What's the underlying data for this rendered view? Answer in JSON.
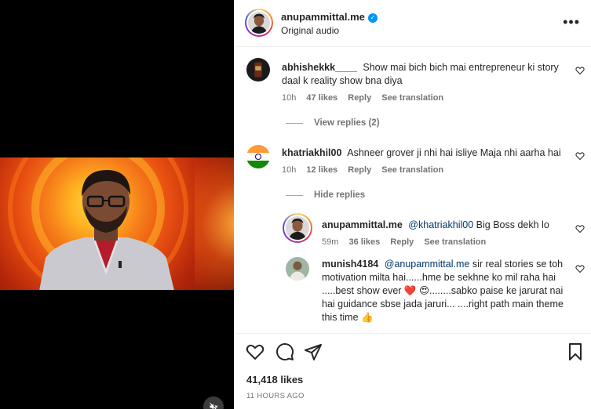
{
  "post": {
    "author": "anupammittal.me",
    "audio": "Original audio",
    "more_label": "•••",
    "likes": "41,418 likes",
    "time": "11 HOURS AGO"
  },
  "comments": [
    {
      "user": "abhishekkk____",
      "text": "Show mai bich bich mai entrepreneur ki story daal k reality show bna diya",
      "age": "10h",
      "likes": "47 likes",
      "reply": "Reply",
      "translate": "See translation",
      "replies_toggle": "View replies (2)"
    },
    {
      "user": "khatriakhil00",
      "text": "Ashneer grover ji nhi hai isliye Maja nhi aarha hai",
      "age": "10h",
      "likes": "12 likes",
      "reply": "Reply",
      "translate": "See translation",
      "replies_toggle": "Hide replies",
      "replies": [
        {
          "user": "anupammittal.me",
          "mention": "@khatriakhil00",
          "text": "Big Boss dekh lo",
          "age": "59m",
          "likes": "36 likes",
          "reply": "Reply",
          "translate": "See translation"
        },
        {
          "user": "munish4184",
          "mention": "@anupammittal.me",
          "text_1": "sir real stories se toh motivation milta hai......hme be sekhne ko mil raha hai .....best show ever",
          "emoji_1": "❤️",
          "emoji_2": "😍",
          "text_2": "........sabko paise ke jarurat nai hai guidance sbse jada jaruri... ....right path main theme this time",
          "emoji_3": "👍"
        }
      ]
    }
  ],
  "icons": {
    "heart": "heart-icon",
    "comment": "comment-icon",
    "share": "share-icon",
    "save": "bookmark-icon",
    "mute": "muted-speaker-icon"
  },
  "colors": {
    "verified": "#0095f6",
    "mention": "#00376b",
    "muted_text": "#737373",
    "emoji_heart": "#e0245e"
  }
}
